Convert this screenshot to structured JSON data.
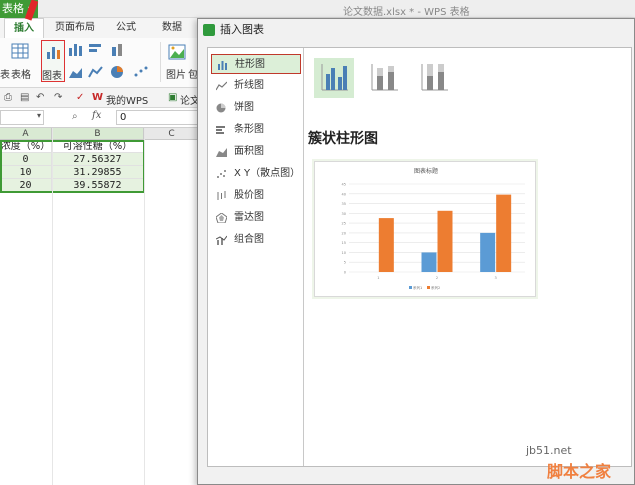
{
  "app": {
    "menu_label": "表格",
    "window_title": "论文数据.xlsx * - WPS 表格"
  },
  "ribbon": {
    "tabs": [
      "插入",
      "页面布局",
      "公式",
      "数据"
    ],
    "buttons": {
      "table_partial": "表",
      "table": "表格",
      "chart": "图表",
      "picture": "图片",
      "partial": "包"
    }
  },
  "quickbar": {
    "my_wps": "我的WPS",
    "doc_tab": "论文"
  },
  "formula_bar": {
    "fx": "fx",
    "value": "0"
  },
  "sheet": {
    "columns": [
      "A",
      "B",
      "C"
    ],
    "header_row": [
      "浓度（%）",
      "可溶性糖（%）"
    ],
    "rows": [
      [
        "0",
        "27.56327"
      ],
      [
        "10",
        "31.29855"
      ],
      [
        "20",
        "39.55872"
      ]
    ]
  },
  "dialog": {
    "title": "插入图表",
    "chart_types": [
      "柱形图",
      "折线图",
      "饼图",
      "条形图",
      "面积图",
      "X Y（散点图）",
      "股价图",
      "雷达图",
      "组合图"
    ],
    "selected_type": "柱形图",
    "subtype_title": "簇状柱形图",
    "preview_title": "图表标题"
  },
  "chart_data": {
    "type": "bar",
    "title": "图表标题",
    "categories": [
      "1",
      "2",
      "3"
    ],
    "series": [
      {
        "name": "系列1",
        "values": [
          0,
          10,
          20
        ],
        "color": "#5b9bd5"
      },
      {
        "name": "系列2",
        "values": [
          27.56327,
          31.29855,
          39.55872
        ],
        "color": "#ed7d31"
      }
    ],
    "ylim": [
      0,
      45
    ],
    "yticks": [
      0,
      5,
      10,
      15,
      20,
      25,
      30,
      35,
      40,
      45
    ],
    "legend": "bottom",
    "grid": true
  },
  "watermark": {
    "site": "jb51.net",
    "label": "脚本之家"
  },
  "colors": {
    "accent": "#3f9a35",
    "arrow": "#e02828"
  }
}
